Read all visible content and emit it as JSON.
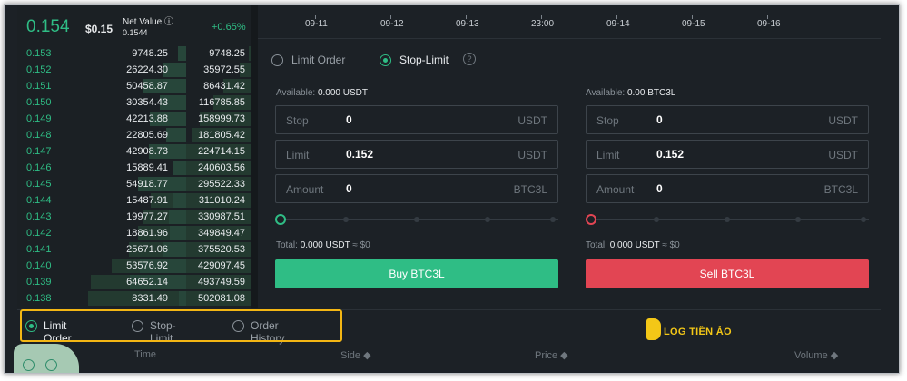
{
  "header": {
    "last_price": "0.154",
    "price_usd": "$0.15",
    "net_value_label": "Net Value ⓘ",
    "net_value": "0.1544",
    "change": "+0.65%"
  },
  "timeline": [
    "09-11",
    "09-12",
    "09-13",
    "23:00",
    "09-14",
    "09-15",
    "09-16"
  ],
  "order_book": [
    {
      "price": "0.153",
      "amount": "9748.25",
      "total": "9748.25"
    },
    {
      "price": "0.152",
      "amount": "26224.30",
      "total": "35972.55"
    },
    {
      "price": "0.151",
      "amount": "50458.87",
      "total": "86431.42"
    },
    {
      "price": "0.150",
      "amount": "30354.43",
      "total": "116785.85"
    },
    {
      "price": "0.149",
      "amount": "42213.88",
      "total": "158999.73"
    },
    {
      "price": "0.148",
      "amount": "22805.69",
      "total": "181805.42"
    },
    {
      "price": "0.147",
      "amount": "42908.73",
      "total": "224714.15"
    },
    {
      "price": "0.146",
      "amount": "15889.41",
      "total": "240603.56"
    },
    {
      "price": "0.145",
      "amount": "54918.77",
      "total": "295522.33"
    },
    {
      "price": "0.144",
      "amount": "15487.91",
      "total": "311010.24"
    },
    {
      "price": "0.143",
      "amount": "19977.27",
      "total": "330987.51"
    },
    {
      "price": "0.142",
      "amount": "18861.96",
      "total": "349849.47"
    },
    {
      "price": "0.141",
      "amount": "25671.06",
      "total": "375520.53"
    },
    {
      "price": "0.140",
      "amount": "53576.92",
      "total": "429097.45"
    },
    {
      "price": "0.139",
      "amount": "64652.14",
      "total": "493749.59"
    },
    {
      "price": "0.138",
      "amount": "8331.49",
      "total": "502081.08"
    }
  ],
  "order_type": {
    "limit": "Limit Order",
    "stop_limit": "Stop-Limit",
    "selected": "Stop-Limit",
    "help_icon": "question-circle-icon"
  },
  "buy": {
    "available_label": "Available:",
    "available": "0.000 USDT",
    "stop": {
      "label": "Stop",
      "value": "0",
      "unit": "USDT"
    },
    "limit": {
      "label": "Limit",
      "value": "0.152",
      "unit": "USDT"
    },
    "amount": {
      "label": "Amount",
      "value": "0",
      "unit": "BTC3L"
    },
    "slider_percent": 0,
    "total_label": "Total:",
    "total": "0.000 USDT",
    "total_approx": "≈ $0",
    "button": "Buy BTC3L"
  },
  "sell": {
    "available_label": "Available:",
    "available": "0.00 BTC3L",
    "stop": {
      "label": "Stop",
      "value": "0",
      "unit": "USDT"
    },
    "limit": {
      "label": "Limit",
      "value": "0.152",
      "unit": "USDT"
    },
    "amount": {
      "label": "Amount",
      "value": "0",
      "unit": "BTC3L"
    },
    "slider_percent": 0,
    "total_label": "Total:",
    "total": "0.000 USDT",
    "total_approx": "≈ $0",
    "button": "Sell BTC3L"
  },
  "bottom_tabs": {
    "limit": "Limit Order",
    "stop_limit": "Stop-Limit",
    "history": "Order History",
    "selected": "Limit Order"
  },
  "orders_columns": {
    "time": "Time",
    "side": "Side ◆",
    "price": "Price ◆",
    "volume": "Volume ◆"
  },
  "watermark": "LOG TIỀN ẢO",
  "colors": {
    "buy": "#2fbd85",
    "sell": "#e24553",
    "highlight": "#f3b614",
    "background": "#1c2126"
  }
}
